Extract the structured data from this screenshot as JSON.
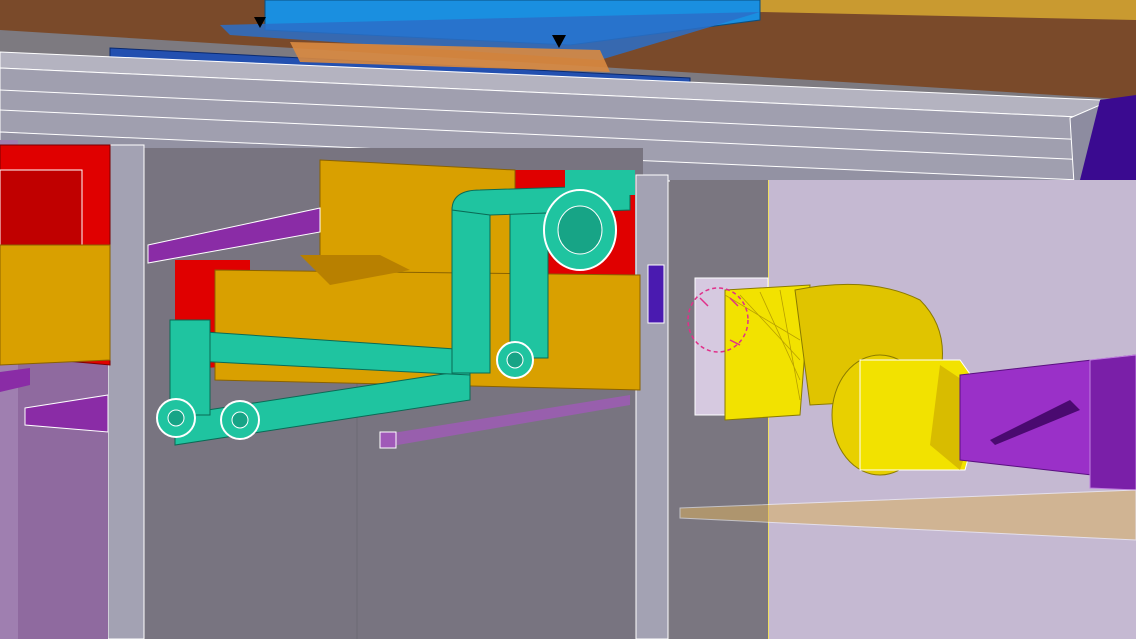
{
  "viewport": {
    "kind": "3D BIM model view",
    "has_text": false
  },
  "colors": {
    "background_wall": "#7d7a80",
    "right_wall": "#c5b9d2",
    "ceiling_slab": "#7a4a2a",
    "beam": "#a7a6b4",
    "hvac_duct_blue": "#1a8fe0",
    "mechanical_duct_orange": "#d9a000",
    "fire_duct_red": "#e00000",
    "pipe_teal": "#1fc4a0",
    "cable_tray_purple": "#8a2ca6",
    "flexible_duct_yellow": "#e8d000",
    "selection_marker_magenta": "#e0308a"
  },
  "icons": {
    "marker_left": "down-triangle-marker",
    "marker_right": "down-triangle-marker",
    "selection": "dashed-circle-selection"
  }
}
